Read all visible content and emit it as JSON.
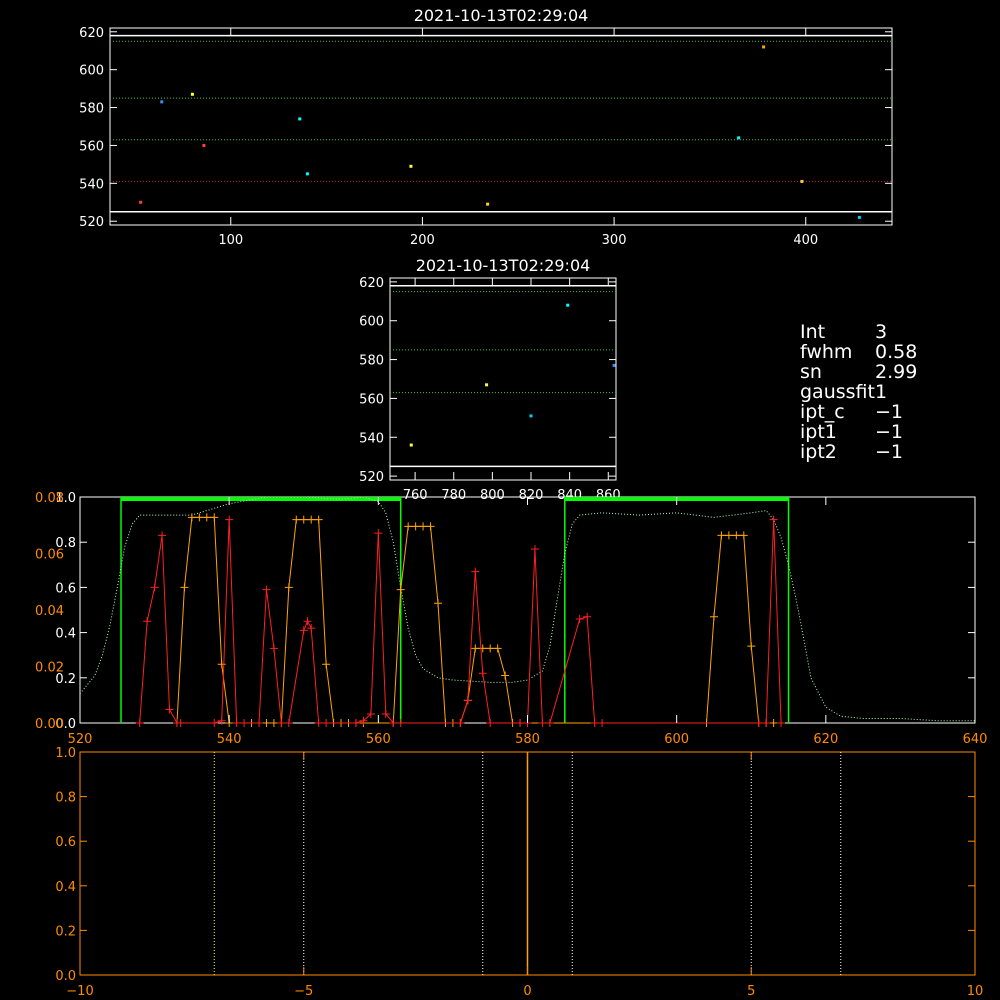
{
  "colors": {
    "background": "#000000",
    "white": "#ffffff",
    "green": "#00ff00",
    "green_dotted": "#33cc33",
    "red": "#ff2020",
    "orange": "#ffa500",
    "dark_red": "#d02020",
    "cyan": "#00ffff",
    "yellow": "#ffff33"
  },
  "info_panel": [
    {
      "key": "Int",
      "value": "3"
    },
    {
      "key": "fwhm",
      "value": "0.58"
    },
    {
      "key": "sn",
      "value": "2.99"
    },
    {
      "key": "gaussfit",
      "value": "1"
    },
    {
      "key": "ipt_c",
      "value": "-1"
    },
    {
      "key": "ipt1",
      "value": "-1"
    },
    {
      "key": "ipt2",
      "value": "-1"
    }
  ],
  "chart_data": [
    {
      "id": "top",
      "type": "scatter",
      "title": "2021-10-13T02:29:04",
      "xlim": [
        37,
        445
      ],
      "ylim": [
        518,
        622
      ],
      "xticks": [
        100,
        200,
        300,
        400
      ],
      "yticks": [
        520,
        540,
        560,
        580,
        600,
        620
      ],
      "hlines_solid": [
        {
          "y": 618,
          "color": "#ffffff"
        },
        {
          "y": 525,
          "color": "#ffffff"
        }
      ],
      "hlines_dotted": [
        {
          "y": 615,
          "color": "#33cc33"
        },
        {
          "y": 585,
          "color": "#33cc33"
        },
        {
          "y": 563,
          "color": "#33cc33"
        },
        {
          "y": 541,
          "color": "#cc2222"
        }
      ],
      "points": [
        {
          "x": 53,
          "y": 530,
          "color": "#ff4040"
        },
        {
          "x": 64,
          "y": 583,
          "color": "#4488ff"
        },
        {
          "x": 80,
          "y": 587,
          "color": "#ffff33"
        },
        {
          "x": 86,
          "y": 560,
          "color": "#ff4040"
        },
        {
          "x": 136,
          "y": 574,
          "color": "#00ffff"
        },
        {
          "x": 140,
          "y": 545,
          "color": "#00ffff"
        },
        {
          "x": 194,
          "y": 549,
          "color": "#ffff33"
        },
        {
          "x": 234,
          "y": 529,
          "color": "#ffcc33"
        },
        {
          "x": 365,
          "y": 564,
          "color": "#00ffff"
        },
        {
          "x": 378,
          "y": 612,
          "color": "#ffa500"
        },
        {
          "x": 398,
          "y": 541,
          "color": "#ffcc33"
        },
        {
          "x": 428,
          "y": 522,
          "color": "#00ccff"
        }
      ]
    },
    {
      "id": "mid",
      "type": "scatter",
      "title": "2021-10-13T02:29:04",
      "xlim": [
        747,
        864
      ],
      "ylim": [
        518,
        622
      ],
      "xticks": [
        760,
        780,
        800,
        820,
        840,
        860
      ],
      "yticks": [
        520,
        540,
        560,
        580,
        600,
        620
      ],
      "hlines_solid": [
        {
          "y": 618,
          "color": "#ffffff"
        },
        {
          "y": 525,
          "color": "#ffffff"
        }
      ],
      "hlines_dotted": [
        {
          "y": 615,
          "color": "#33cc33"
        },
        {
          "y": 585,
          "color": "#33cc33"
        },
        {
          "y": 563,
          "color": "#33cc33"
        }
      ],
      "points": [
        {
          "x": 758,
          "y": 536,
          "color": "#ffff33"
        },
        {
          "x": 797,
          "y": 567,
          "color": "#ffff33"
        },
        {
          "x": 820,
          "y": 551,
          "color": "#00ccff"
        },
        {
          "x": 839,
          "y": 608,
          "color": "#00ffff"
        },
        {
          "x": 863,
          "y": 577,
          "color": "#4488ff"
        }
      ]
    },
    {
      "id": "spectrum",
      "type": "line",
      "xlim": [
        520,
        640
      ],
      "ylim": [
        0,
        1.0
      ],
      "xticks": [
        520,
        540,
        560,
        580,
        600,
        620,
        640
      ],
      "yticks_left_white": [
        "0.0",
        "0.2",
        "0.4",
        "0.6",
        "0.8",
        "1.0"
      ],
      "yticks_left_orange": [
        "0.00",
        "0.02",
        "0.04",
        "0.06",
        "0.08"
      ],
      "yticks_right_values": [
        0,
        0.2,
        0.4,
        0.6,
        0.8,
        1.0
      ],
      "filter_boxes": [
        [
          525.5,
          563
        ],
        [
          585,
          615
        ]
      ],
      "transmission_curve": {
        "x": [
          520,
          522,
          523,
          524,
          525,
          526,
          527,
          528,
          530,
          535,
          540,
          545,
          550,
          555,
          558,
          560,
          561,
          562,
          563,
          564,
          565,
          566,
          568,
          570,
          575,
          578,
          580,
          582,
          583,
          584,
          585,
          586,
          587,
          590,
          595,
          600,
          605,
          610,
          612,
          613,
          614,
          615,
          616,
          617,
          618,
          620,
          622,
          625,
          630,
          635,
          640
        ],
        "y": [
          0.13,
          0.21,
          0.3,
          0.43,
          0.6,
          0.78,
          0.88,
          0.92,
          0.92,
          0.92,
          0.97,
          1.0,
          1.0,
          0.99,
          1.0,
          0.98,
          0.93,
          0.8,
          0.6,
          0.42,
          0.3,
          0.24,
          0.2,
          0.19,
          0.18,
          0.18,
          0.19,
          0.23,
          0.34,
          0.55,
          0.75,
          0.88,
          0.92,
          0.93,
          0.92,
          0.93,
          0.91,
          0.93,
          0.94,
          0.9,
          0.82,
          0.7,
          0.55,
          0.38,
          0.2,
          0.07,
          0.03,
          0.02,
          0.02,
          0.01,
          0.01
        ]
      },
      "red_series": {
        "x": [
          528,
          529,
          530,
          531,
          532,
          533,
          533.5,
          538,
          539,
          540,
          541,
          542,
          544,
          545,
          546,
          547,
          548,
          550,
          550.5,
          551,
          552,
          553,
          557,
          558,
          559,
          560,
          561,
          562,
          563,
          571,
          572,
          573,
          574,
          575,
          579,
          580,
          581,
          582,
          583,
          587,
          588,
          589,
          590,
          611,
          612,
          613,
          614
        ],
        "y": [
          0,
          0.45,
          0.6,
          0.83,
          0.06,
          0,
          0,
          0,
          0.01,
          0.9,
          0,
          0,
          0,
          0.59,
          0.33,
          0,
          0,
          0.41,
          0.45,
          0.42,
          0,
          0,
          0,
          0.01,
          0.04,
          0.84,
          0.04,
          0,
          0,
          0,
          0.1,
          0.67,
          0.22,
          0,
          0,
          0,
          0.77,
          0,
          0,
          0.46,
          0.47,
          0,
          0,
          0,
          0,
          0.9,
          0
        ]
      },
      "orange_series": {
        "x": [
          533,
          534,
          535,
          536,
          537,
          538,
          539,
          540,
          543,
          544,
          545,
          546,
          547,
          548,
          549,
          550,
          551,
          552,
          553,
          554,
          555,
          556,
          557,
          558,
          562,
          563,
          564,
          565,
          566,
          567,
          568,
          569,
          570,
          571,
          572,
          573,
          574,
          575,
          576,
          577,
          578,
          579,
          580,
          604,
          605,
          606,
          607,
          608,
          609,
          610,
          611,
          612,
          613
        ],
        "y": [
          0,
          0.6,
          0.91,
          0.91,
          0.91,
          0.91,
          0.26,
          0,
          0,
          0,
          0,
          0,
          0,
          0.6,
          0.9,
          0.9,
          0.9,
          0.9,
          0.26,
          0,
          0,
          0,
          0,
          0,
          0,
          0.59,
          0.87,
          0.87,
          0.87,
          0.87,
          0.53,
          0,
          0,
          0,
          0.1,
          0.33,
          0.33,
          0.33,
          0.33,
          0.21,
          0,
          0,
          0,
          0,
          0.47,
          0.83,
          0.83,
          0.83,
          0.83,
          0.34,
          0,
          0,
          0
        ]
      }
    },
    {
      "id": "bottom",
      "type": "line",
      "xlim": [
        -10,
        10
      ],
      "ylim": [
        0,
        1.0
      ],
      "xticks": [
        -10,
        -5,
        0,
        5,
        10
      ],
      "yticks": [
        "0.0",
        "0.2",
        "0.4",
        "0.6",
        "0.8",
        "1.0"
      ],
      "vlines_dotted": [
        {
          "x": -7,
          "color": "#ffff33"
        },
        {
          "x": -5,
          "color": "#ffffff"
        },
        {
          "x": -1,
          "color": "#ffffff"
        },
        {
          "x": 1,
          "color": "#ffffff"
        },
        {
          "x": 5,
          "color": "#ffffff"
        },
        {
          "x": 7,
          "color": "#ffffff"
        }
      ],
      "vline_solid": {
        "x": 0,
        "color": "#ffa500"
      }
    }
  ]
}
